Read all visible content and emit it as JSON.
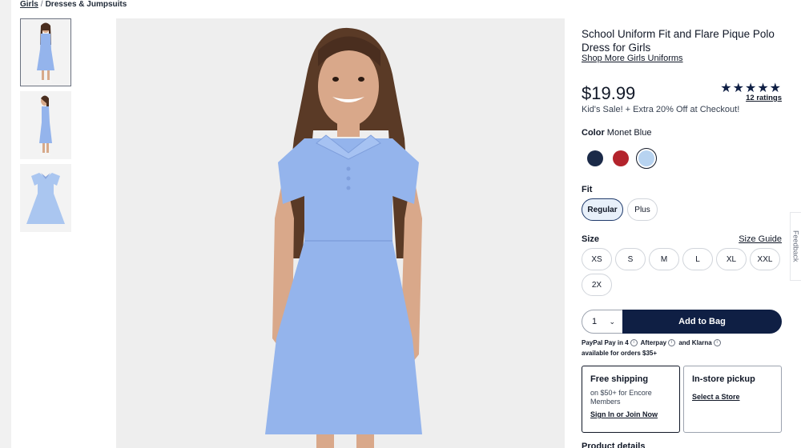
{
  "breadcrumb": {
    "root": "Girls",
    "separator": "/",
    "current": "Dresses & Jumpsuits"
  },
  "product": {
    "title": "School Uniform Fit and Flare Pique Polo Dress for Girls",
    "more_link": "Shop More Girls Uniforms",
    "price": "$19.99",
    "stars": "★★★★★",
    "rating_value": 5,
    "ratings_label": "12 ratings",
    "sale_text": "Kid's Sale! + Extra 20% Off at Checkout!"
  },
  "color": {
    "label": "Color",
    "selected": "Monet Blue",
    "swatches": [
      {
        "name": "navy",
        "hex": "#1b2a48"
      },
      {
        "name": "red",
        "hex": "#b3232c"
      },
      {
        "name": "Monet Blue",
        "hex": "#b7d3f0"
      }
    ]
  },
  "fit": {
    "label": "Fit",
    "options": [
      "Regular",
      "Plus"
    ],
    "selected": "Regular"
  },
  "size": {
    "label": "Size",
    "guide_label": "Size Guide",
    "options": [
      "XS",
      "S",
      "M",
      "L",
      "XL",
      "XXL",
      "2X"
    ]
  },
  "cart": {
    "quantity": "1",
    "add_label": "Add to Bag"
  },
  "payment": {
    "line1_prefix": "PayPal Pay in 4",
    "afterpay": "Afterpay",
    "and": "and",
    "klarna": "Klarna",
    "line2": "available for orders $35+"
  },
  "shipping": {
    "title": "Free shipping",
    "sub": "on $50+ for Encore Members",
    "link": "Sign In or Join Now"
  },
  "pickup": {
    "title": "In-store pickup",
    "link": "Select a Store"
  },
  "cut_heading": "Product details",
  "feedback_label": "Feedback",
  "colors": {
    "navy_button": "#0f1f44",
    "dress_blue": "#94b4ec",
    "background": "#eeeeee"
  }
}
